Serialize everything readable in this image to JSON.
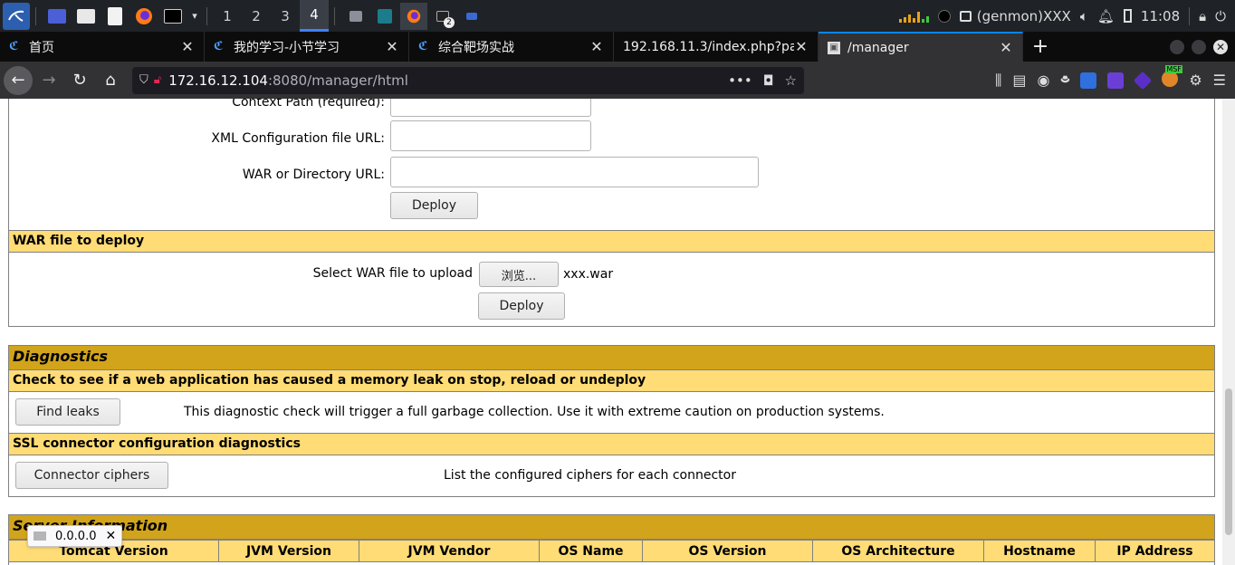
{
  "taskbar": {
    "workspaces": [
      "1",
      "2",
      "3",
      "4"
    ],
    "active_workspace": "4",
    "terminal_badge": "2",
    "genmon": "(genmon)XXX",
    "clock": "11:08"
  },
  "tabs": [
    {
      "title": "首页",
      "active": false
    },
    {
      "title": "我的学习-小节学习",
      "active": false
    },
    {
      "title": "综合靶场实战",
      "active": false
    },
    {
      "title": "192.168.11.3/index.php?page",
      "active": false
    },
    {
      "title": "/manager",
      "active": true
    }
  ],
  "url": {
    "host": "172.16.12.104",
    "path": ":8080/manager/html"
  },
  "ext_badge": "MSF",
  "deploy_dir": {
    "context_path_label": "Context Path (required):",
    "xml_config_label": "XML Configuration file URL:",
    "war_dir_label": "WAR or Directory URL:",
    "deploy_button": "Deploy"
  },
  "war_upload": {
    "header": "WAR file to deploy",
    "select_label": "Select WAR file to upload",
    "browse_button": "浏览...",
    "file_name": "xxx.war",
    "deploy_button": "Deploy"
  },
  "diagnostics": {
    "title": "Diagnostics",
    "leak_header": "Check to see if a web application has caused a memory leak on stop, reload or undeploy",
    "find_leaks_button": "Find leaks",
    "find_leaks_desc": "This diagnostic check will trigger a full garbage collection. Use it with extreme caution on production systems.",
    "ssl_header": "SSL connector configuration diagnostics",
    "ciphers_button": "Connector ciphers",
    "ciphers_desc": "List the configured ciphers for each connector"
  },
  "server_info": {
    "title": "Server Information",
    "columns": [
      "Tomcat Version",
      "JVM Version",
      "JVM Vendor",
      "OS Name",
      "OS Version",
      "OS Architecture",
      "Hostname",
      "IP Address"
    ]
  },
  "status_popup": {
    "text": "0.0.0.0"
  }
}
